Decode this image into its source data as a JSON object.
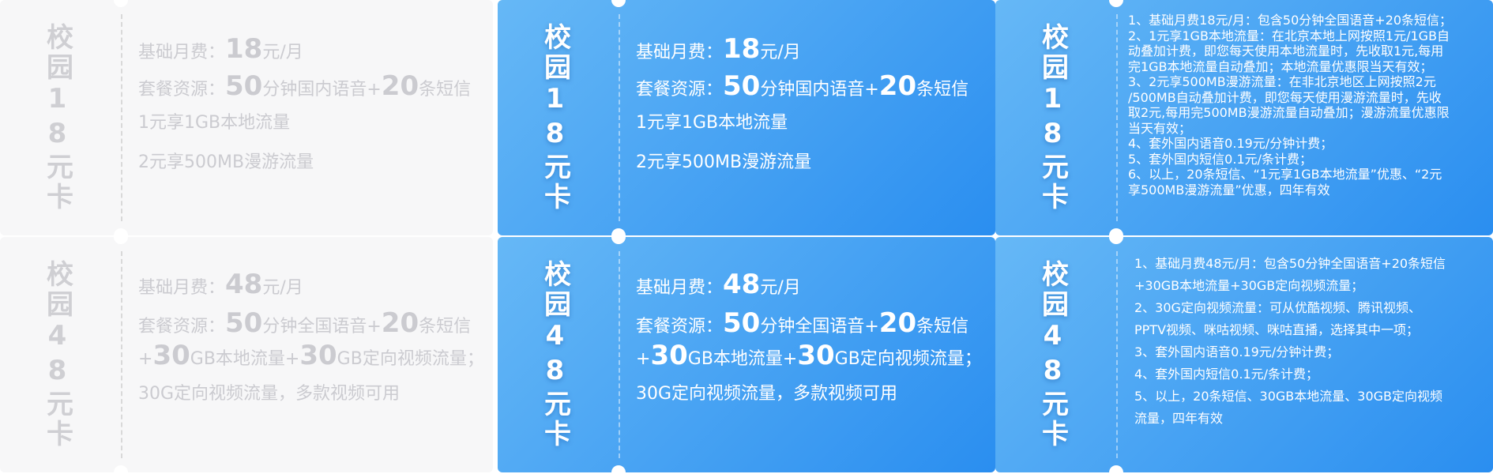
{
  "cards": {
    "c18_gray": {
      "stub": "校园18元卡",
      "lines": [
        {
          "pre": "基础月费：",
          "b1": "18",
          "mid": "元/月",
          "b2": "",
          "post": ""
        },
        {
          "pre": "套餐资源：",
          "b1": "50",
          "mid": "分钟国内语音+",
          "b2": "20",
          "post": "条短信"
        },
        {
          "pre": "1元享1GB本地流量",
          "b1": "",
          "mid": "",
          "b2": "",
          "post": ""
        },
        {
          "pre": "2元享500MB漫游流量",
          "b1": "",
          "mid": "",
          "b2": "",
          "post": ""
        }
      ]
    },
    "c18_blue": {
      "stub": "校园18元卡",
      "lines": [
        {
          "pre": "基础月费：",
          "b1": "18",
          "mid": "元/月",
          "b2": "",
          "post": ""
        },
        {
          "pre": "套餐资源：",
          "b1": "50",
          "mid": "分钟国内语音+",
          "b2": "20",
          "post": "条短信"
        },
        {
          "pre": "1元享1GB本地流量",
          "b1": "",
          "mid": "",
          "b2": "",
          "post": ""
        },
        {
          "pre": "2元享500MB漫游流量",
          "b1": "",
          "mid": "",
          "b2": "",
          "post": ""
        }
      ]
    },
    "c18_rules": {
      "stub": "校园18元卡",
      "rules": [
        "1、基础月费18元/月：包含50分钟全国语音+20条短信；",
        "2、1元享1GB本地流量：在北京本地上网按照1元/1GB自",
        "动叠加计费，即您每天使用本地流量时，先收取1元,每用",
        "完1GB本地流量自动叠加；本地流量优惠限当天有效；",
        "3、2元享500MB漫游流量：在非北京地区上网按照2元",
        "/500MB自动叠加计费，即您每天使用漫游流量时，先收",
        "取2元,每用完500MB漫游流量自动叠加；漫游流量优惠限",
        "当天有效；",
        "4、套外国内语音0.19元/分钟计费；",
        "5、套外国内短信0.1元/条计费；",
        "6、以上，20条短信、“1元享1GB本地流量”优惠、“2元",
        "享500MB漫游流量”优惠，四年有效"
      ]
    },
    "c48_gray": {
      "stub": "校园48元卡",
      "lines": [
        {
          "pre": "基础月费：",
          "b1": "48",
          "mid": "元/月",
          "b2": "",
          "post": ""
        },
        {
          "pre": "套餐资源：",
          "b1": "50",
          "mid": "分钟全国语音+",
          "b2": "20",
          "post": "条短信"
        },
        {
          "pre": "+",
          "b1": "30",
          "mid": "GB本地流量+",
          "b2": "30",
          "post": "GB定向视频流量；"
        },
        {
          "pre": "30G定向视频流量，多款视频可用",
          "b1": "",
          "mid": "",
          "b2": "",
          "post": ""
        }
      ]
    },
    "c48_blue": {
      "stub": "校园48元卡",
      "lines": [
        {
          "pre": "基础月费：",
          "b1": "48",
          "mid": "元/月",
          "b2": "",
          "post": ""
        },
        {
          "pre": "套餐资源：",
          "b1": "50",
          "mid": "分钟全国语音+",
          "b2": "20",
          "post": "条短信"
        },
        {
          "pre": "+",
          "b1": "30",
          "mid": "GB本地流量+",
          "b2": "30",
          "post": "GB定向视频流量；"
        },
        {
          "pre": "30G定向视频流量，多款视频可用",
          "b1": "",
          "mid": "",
          "b2": "",
          "post": ""
        }
      ]
    },
    "c48_rules": {
      "stub": "校园48元卡",
      "rules": [
        "1、基础月费48元/月：包含50分钟全国语音+20条短信",
        "+30GB本地流量+30GB定向视频流量；",
        "2、30G定向视频流量：可从优酷视频、腾讯视频、",
        "PPTV视频、咪咕视频、咪咕直播，选择其中一项；",
        "3、套外国内语音0.19元/分钟计费；",
        "4、套外国内短信0.1元/条计费；",
        "5、以上，20条短信、30GB本地流量、30GB定向视频",
        "流量，四年有效"
      ]
    }
  }
}
